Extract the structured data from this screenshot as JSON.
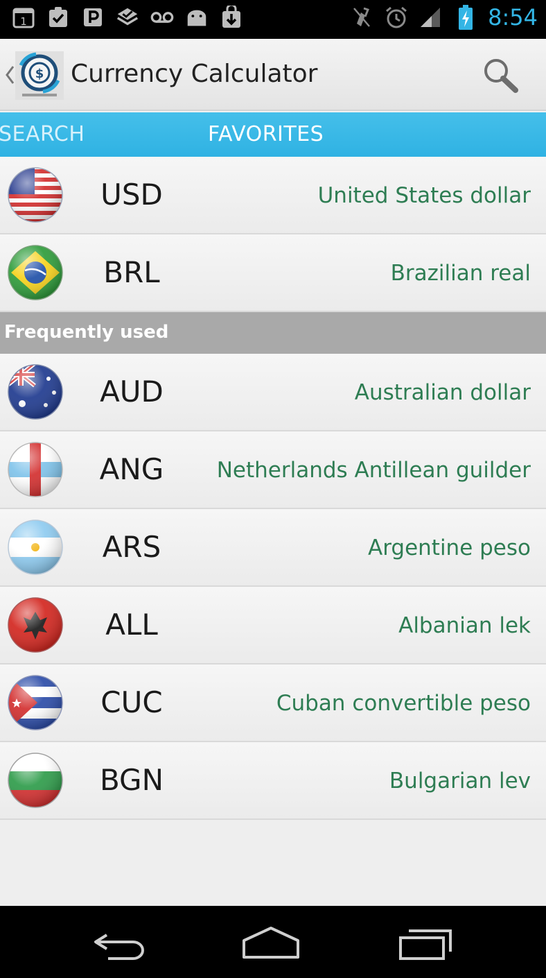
{
  "status_bar": {
    "time": "8:54",
    "colors": {
      "time": "#33b5e5",
      "icons": "#bdbdbd"
    },
    "left_icons": [
      "calendar-icon",
      "task-check-icon",
      "parking-icon",
      "ingress-icon",
      "voicemail-icon",
      "android-icon",
      "download-icon"
    ],
    "right_icons": [
      "mute-icon",
      "alarm-icon",
      "signal-icon",
      "battery-charging-icon"
    ]
  },
  "action_bar": {
    "title": "Currency Calculator",
    "logo_icon": "dollar-coin-icon",
    "search_icon": "search-icon"
  },
  "tabs": [
    {
      "label": "SEARCH",
      "selected": false
    },
    {
      "label": "FAVORITES",
      "selected": true
    }
  ],
  "colors": {
    "tab_bar": "#33b5e5",
    "currency_name": "#2e7d53",
    "section_header": "#a9a9a9"
  },
  "favorites": [
    {
      "code": "USD",
      "name": "United States dollar",
      "flag": "usa-flag-icon"
    },
    {
      "code": "BRL",
      "name": "Brazilian real",
      "flag": "brazil-flag-icon"
    }
  ],
  "section_header": "Frequently used",
  "frequent": [
    {
      "code": "AUD",
      "name": "Australian dollar",
      "flag": "australia-flag-icon"
    },
    {
      "code": "ANG",
      "name": "Netherlands Antillean guilder",
      "flag": "netherlands-antilles-flag-icon"
    },
    {
      "code": "ARS",
      "name": "Argentine peso",
      "flag": "argentina-flag-icon"
    },
    {
      "code": "ALL",
      "name": "Albanian lek",
      "flag": "albania-flag-icon"
    },
    {
      "code": "CUC",
      "name": "Cuban convertible peso",
      "flag": "cuba-flag-icon"
    },
    {
      "code": "BGN",
      "name": "Bulgarian lev",
      "flag": "bulgaria-flag-icon"
    }
  ],
  "nav_bar": [
    "back-icon",
    "home-icon",
    "recent-apps-icon"
  ]
}
